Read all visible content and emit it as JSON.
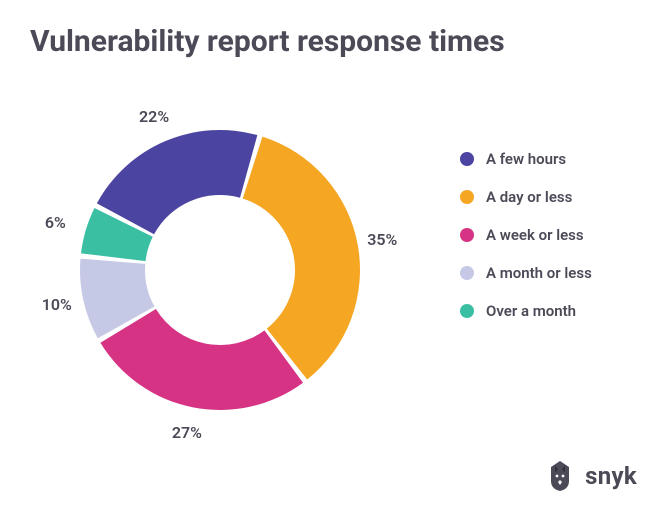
{
  "title": "Vulnerability report response times",
  "chart_data": {
    "type": "pie",
    "title": "Vulnerability report response times",
    "series": [
      {
        "name": "A few hours",
        "value": 22,
        "label": "22%",
        "color": "#4b45a1"
      },
      {
        "name": "A day or less",
        "value": 35,
        "label": "35%",
        "color": "#f5a623"
      },
      {
        "name": "A week or less",
        "value": 27,
        "label": "27%",
        "color": "#d63384"
      },
      {
        "name": "A month or less",
        "value": 10,
        "label": "10%",
        "color": "#c6c9e6"
      },
      {
        "name": "Over a month",
        "value": 6,
        "label": "6%",
        "color": "#3bbfa3"
      }
    ]
  },
  "legend": {
    "items": [
      {
        "label": "A few hours",
        "color": "#4b45a1"
      },
      {
        "label": "A day or less",
        "color": "#f5a623"
      },
      {
        "label": "A week or less",
        "color": "#d63384"
      },
      {
        "label": "A month or less",
        "color": "#c6c9e6"
      },
      {
        "label": "Over a month",
        "color": "#3bbfa3"
      }
    ]
  },
  "brand": {
    "name": "snyk"
  }
}
